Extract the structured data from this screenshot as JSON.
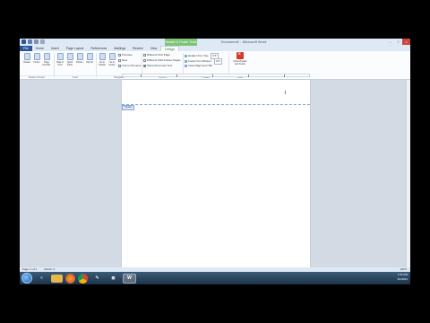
{
  "window": {
    "title": "Document1 - Microsoft Word",
    "context_tab_header": "Header & Footer Tools",
    "controls": {
      "minimize": "–",
      "maximize": "□",
      "close": "×"
    }
  },
  "tabs": [
    "File",
    "Home",
    "Insert",
    "Page Layout",
    "References",
    "Mailings",
    "Review",
    "View",
    "Design"
  ],
  "ribbon": {
    "header": "Header",
    "footer": "Footer",
    "page_number": "Page Number",
    "date_time": "Date & Time",
    "quick_parts": "Quick Parts",
    "picture": "Picture",
    "clip_art": "Clip Art",
    "go_to_header": "Go to Header",
    "go_to_footer": "Go to Footer",
    "previous": "Previous",
    "next": "Next",
    "link_to_previous": "Link to Previous",
    "opt_different_first": "Different First Page",
    "opt_different_odd_even": "Different Odd & Even Pages",
    "opt_show_doc_text": "Show Document Text",
    "header_from_top": "Header from Top:",
    "footer_from_bottom": "Footer from Bottom:",
    "insert_alignment_tab": "Insert Alignment Tab",
    "header_value": "0.5\"",
    "footer_value": "0.5\"",
    "close_label": "Close Header and Footer",
    "groups": [
      "Header & Footer",
      "Insert",
      "Navigation",
      "Options",
      "Position",
      "Close"
    ]
  },
  "document": {
    "header_tag": "Header",
    "cursor_glyph": "I"
  },
  "status": {
    "page": "Page: 1 of 1",
    "words": "Words: 0",
    "zoom": "100%"
  },
  "tray": {
    "time": "1:52 PM",
    "date": "3/1/2011"
  },
  "colors": {
    "accent": "#2b579a",
    "context_tab": "#7cc576",
    "close_red": "#d9372c"
  }
}
